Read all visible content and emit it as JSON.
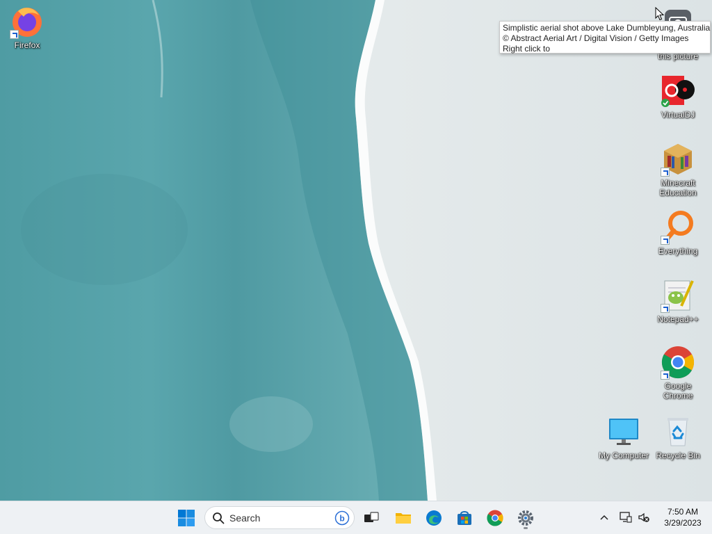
{
  "desktop": {
    "icons": [
      {
        "label": "Firefox"
      },
      {
        "label": "this picture"
      },
      {
        "label": "VirtualDJ"
      },
      {
        "label": "Minecraft Education"
      },
      {
        "label": "Everything"
      },
      {
        "label": "Notepad++"
      },
      {
        "label": "Google Chrome"
      },
      {
        "label": "My Computer"
      },
      {
        "label": "Recycle Bin"
      }
    ],
    "tooltip": {
      "line1": "Simplistic aerial shot above Lake Dumbleyung, Australia",
      "line2": "© Abstract Aerial Art / Digital Vision / Getty Images",
      "line3": "Right click to"
    }
  },
  "taskbar": {
    "search_placeholder": "Search",
    "clock": {
      "time": "7:50 AM",
      "date": "3/29/2023"
    },
    "apps": [
      "start-icon",
      "task-view-icon",
      "file-explorer-icon",
      "edge-icon",
      "microsoft-store-icon",
      "chrome-icon",
      "settings-icon"
    ]
  },
  "colors": {
    "taskbar_bg": "#eef1f4",
    "water": "#5ea7ad",
    "sand": "#e2e8e9",
    "windows_blue": "#0078d4"
  }
}
